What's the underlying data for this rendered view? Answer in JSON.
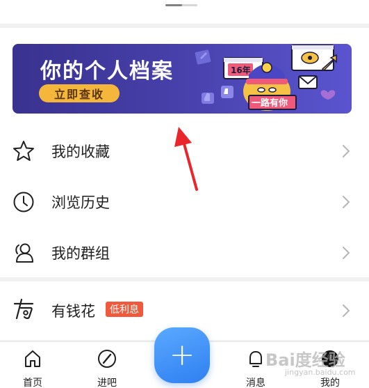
{
  "banner": {
    "title": "你的个人档案",
    "button_label": "立即查收",
    "badge_years": "16年",
    "badge_slogan": "一路有你"
  },
  "menu": {
    "items": [
      {
        "label": "我的收藏",
        "icon": "star-icon"
      },
      {
        "label": "浏览历史",
        "icon": "clock-icon"
      },
      {
        "label": "我的群组",
        "icon": "group-icon"
      }
    ]
  },
  "money": {
    "label": "有钱花",
    "tag": "低利息",
    "icon": "youqianhua-icon"
  },
  "tabbar": {
    "items": [
      {
        "label": "首页",
        "icon": "home-icon"
      },
      {
        "label": "进吧",
        "icon": "compass-icon"
      },
      {
        "label": "消息",
        "icon": "bell-icon"
      },
      {
        "label": "我的",
        "icon": "avatar"
      }
    ],
    "fab_icon": "plus-icon"
  },
  "watermark": {
    "brand": "Bai度经验",
    "url": "jingyan.baidu.com"
  },
  "colors": {
    "banner_start": "#39328f",
    "banner_end": "#5a55cf",
    "banner_button": "#f4b73c",
    "tag": "#ef5a3c",
    "fab": "#2f7ff2",
    "annotation_arrow": "#e8262b"
  }
}
